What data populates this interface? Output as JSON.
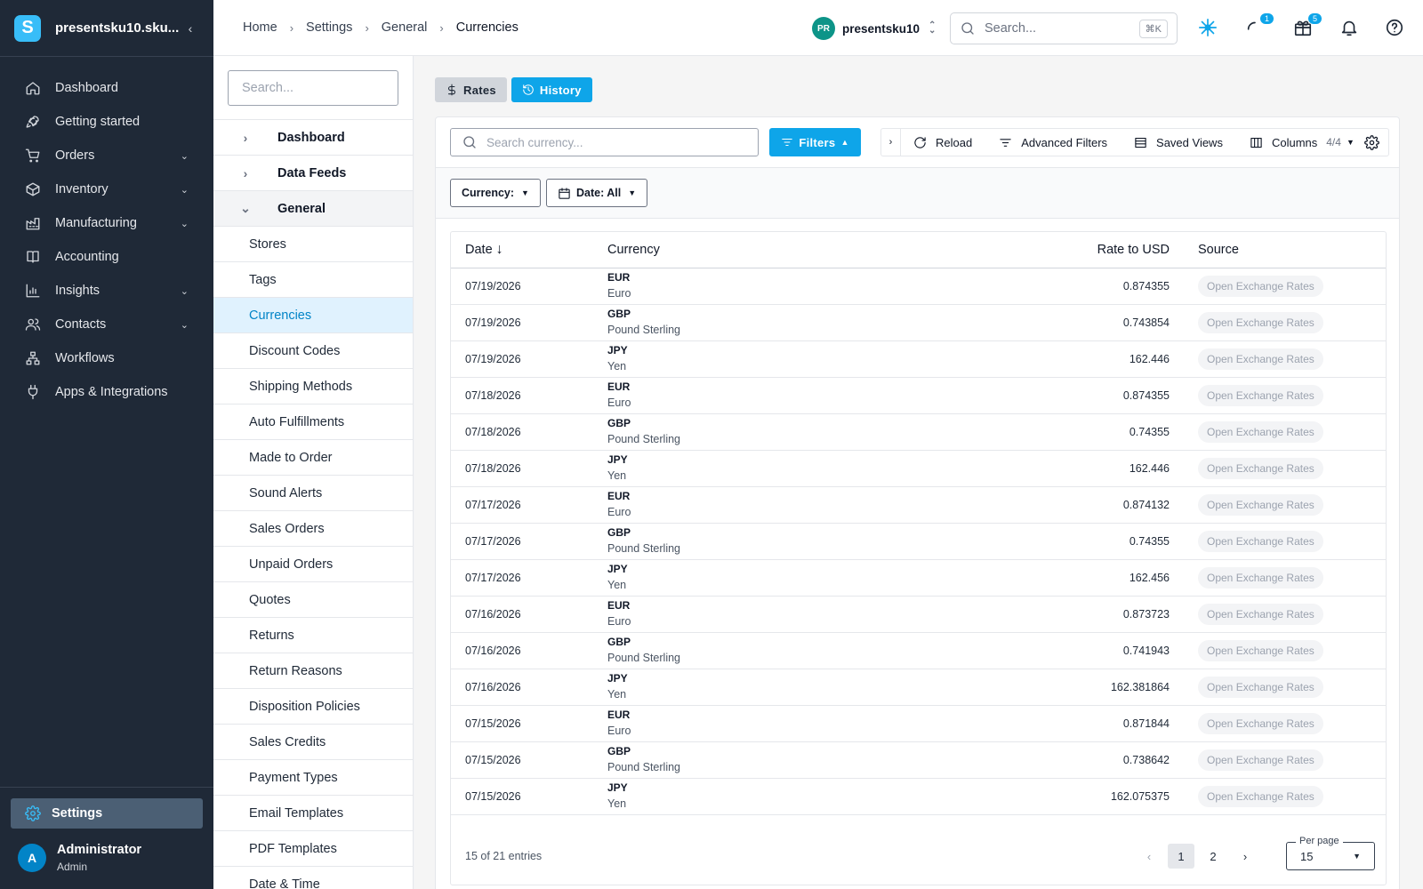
{
  "app": {
    "org_name": "presentsku10.sku...",
    "logo_letter": "S"
  },
  "sidebar": {
    "items": [
      {
        "label": "Dashboard",
        "icon": "home-icon",
        "expandable": false
      },
      {
        "label": "Getting started",
        "icon": "rocket-icon",
        "expandable": false
      },
      {
        "label": "Orders",
        "icon": "cart-icon",
        "expandable": true
      },
      {
        "label": "Inventory",
        "icon": "box-icon",
        "expandable": true
      },
      {
        "label": "Manufacturing",
        "icon": "factory-icon",
        "expandable": true
      },
      {
        "label": "Accounting",
        "icon": "book-icon",
        "expandable": false
      },
      {
        "label": "Insights",
        "icon": "bar-chart-icon",
        "expandable": true
      },
      {
        "label": "Contacts",
        "icon": "users-icon",
        "expandable": true
      },
      {
        "label": "Workflows",
        "icon": "workflow-icon",
        "expandable": false
      },
      {
        "label": "Apps & Integrations",
        "icon": "plug-icon",
        "expandable": false
      }
    ],
    "settings_label": "Settings",
    "user": {
      "initial": "A",
      "name": "Administrator",
      "role": "Admin"
    }
  },
  "header": {
    "breadcrumbs": [
      "Home",
      "Settings",
      "General",
      "Currencies"
    ],
    "account": {
      "initials": "PR",
      "name": "presentsku10"
    },
    "search_placeholder": "Search...",
    "search_shortcut": "⌘K",
    "notifications_badge": "1",
    "gifts_badge": "5"
  },
  "subnav": {
    "search_placeholder": "Search...",
    "groups": [
      {
        "label": "Dashboard",
        "open": false
      },
      {
        "label": "Data Feeds",
        "open": false
      },
      {
        "label": "General",
        "open": true
      }
    ],
    "items": [
      "Stores",
      "Tags",
      "Currencies",
      "Discount Codes",
      "Shipping Methods",
      "Auto Fulfillments",
      "Made to Order",
      "Sound Alerts",
      "Sales Orders",
      "Unpaid Orders",
      "Quotes",
      "Returns",
      "Return Reasons",
      "Disposition Policies",
      "Sales Credits",
      "Payment Types",
      "Email Templates",
      "PDF Templates",
      "Date & Time"
    ],
    "active_item": "Currencies"
  },
  "main": {
    "toggles": {
      "rates": "Rates",
      "history": "History",
      "active": "History"
    },
    "search_placeholder": "Search currency...",
    "filters_label": "Filters",
    "toolbar": {
      "reload": "Reload",
      "advanced_filters": "Advanced Filters",
      "saved_views": "Saved Views",
      "columns": "Columns",
      "columns_count": "4/4"
    },
    "chips": {
      "currency": "Currency:",
      "date": "Date: All"
    },
    "table": {
      "columns": [
        "Date",
        "Currency",
        "Rate to USD",
        "Source"
      ],
      "rows": [
        {
          "date": "07/19/2026",
          "code": "EUR",
          "name": "Euro",
          "rate": "0.874355",
          "source": "Open Exchange Rates"
        },
        {
          "date": "07/19/2026",
          "code": "GBP",
          "name": "Pound Sterling",
          "rate": "0.743854",
          "source": "Open Exchange Rates"
        },
        {
          "date": "07/19/2026",
          "code": "JPY",
          "name": "Yen",
          "rate": "162.446",
          "source": "Open Exchange Rates"
        },
        {
          "date": "07/18/2026",
          "code": "EUR",
          "name": "Euro",
          "rate": "0.874355",
          "source": "Open Exchange Rates"
        },
        {
          "date": "07/18/2026",
          "code": "GBP",
          "name": "Pound Sterling",
          "rate": "0.74355",
          "source": "Open Exchange Rates"
        },
        {
          "date": "07/18/2026",
          "code": "JPY",
          "name": "Yen",
          "rate": "162.446",
          "source": "Open Exchange Rates"
        },
        {
          "date": "07/17/2026",
          "code": "EUR",
          "name": "Euro",
          "rate": "0.874132",
          "source": "Open Exchange Rates"
        },
        {
          "date": "07/17/2026",
          "code": "GBP",
          "name": "Pound Sterling",
          "rate": "0.74355",
          "source": "Open Exchange Rates"
        },
        {
          "date": "07/17/2026",
          "code": "JPY",
          "name": "Yen",
          "rate": "162.456",
          "source": "Open Exchange Rates"
        },
        {
          "date": "07/16/2026",
          "code": "EUR",
          "name": "Euro",
          "rate": "0.873723",
          "source": "Open Exchange Rates"
        },
        {
          "date": "07/16/2026",
          "code": "GBP",
          "name": "Pound Sterling",
          "rate": "0.741943",
          "source": "Open Exchange Rates"
        },
        {
          "date": "07/16/2026",
          "code": "JPY",
          "name": "Yen",
          "rate": "162.381864",
          "source": "Open Exchange Rates"
        },
        {
          "date": "07/15/2026",
          "code": "EUR",
          "name": "Euro",
          "rate": "0.871844",
          "source": "Open Exchange Rates"
        },
        {
          "date": "07/15/2026",
          "code": "GBP",
          "name": "Pound Sterling",
          "rate": "0.738642",
          "source": "Open Exchange Rates"
        },
        {
          "date": "07/15/2026",
          "code": "JPY",
          "name": "Yen",
          "rate": "162.075375",
          "source": "Open Exchange Rates"
        }
      ]
    },
    "pagination": {
      "entries_text": "15 of 21 entries",
      "pages": [
        "1",
        "2"
      ],
      "current": "1",
      "per_page_label": "Per page",
      "per_page": "15"
    }
  },
  "colors": {
    "accent": "#0ea5e9",
    "sidebar_bg": "#1f2937",
    "active_row_bg": "#e0f2fe"
  }
}
